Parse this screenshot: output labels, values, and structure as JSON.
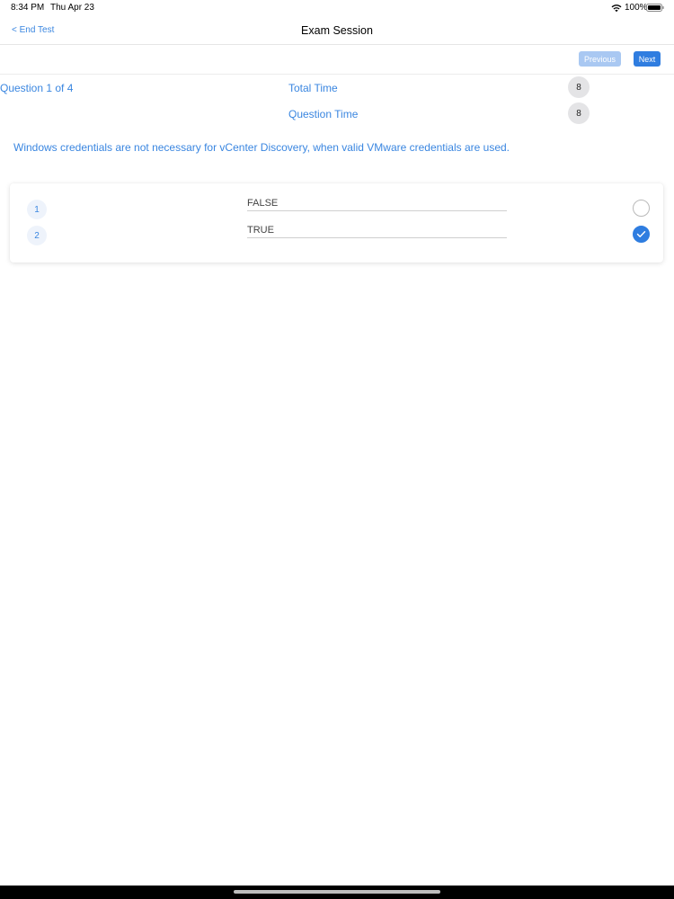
{
  "status_bar": {
    "time": "8:34 PM",
    "date": "Thu Apr 23",
    "battery_percent": "100%",
    "wifi_icon": "wifi-icon",
    "battery_icon": "battery-icon"
  },
  "nav": {
    "back_label": "< End Test",
    "title": "Exam Session"
  },
  "toolbar": {
    "previous_label": "Previous",
    "next_label": "Next"
  },
  "info": {
    "question_counter": "Question 1 of 4",
    "total_time_label": "Total Time",
    "total_time_value": "8",
    "question_time_label": "Question Time",
    "question_time_value": "8"
  },
  "question": {
    "text": "Windows credentials are not necessary for vCenter Discovery, when valid VMware credentials are used."
  },
  "options": [
    {
      "number": "1",
      "text": "FALSE",
      "selected": false
    },
    {
      "number": "2",
      "text": "TRUE",
      "selected": true
    }
  ],
  "colors": {
    "accent": "#2f7de0",
    "text_link": "#3a86e0",
    "button_disabled": "#a9c8f2"
  }
}
